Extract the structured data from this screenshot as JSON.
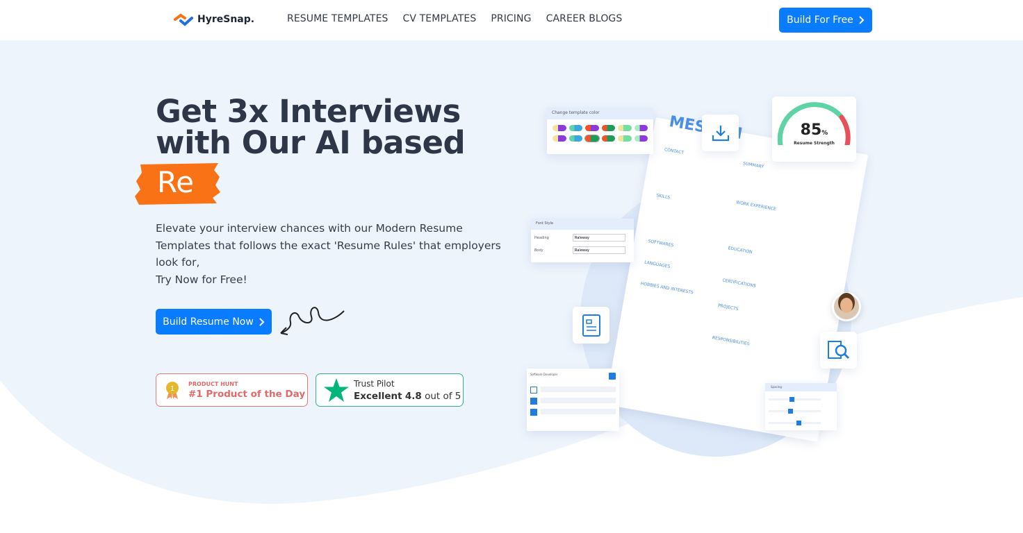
{
  "header": {
    "logo_text": "HyreSnap.",
    "nav": [
      {
        "label": "RESUME TEMPLATES"
      },
      {
        "label": "CV TEMPLATES"
      },
      {
        "label": "PRICING"
      },
      {
        "label": "CAREER BLOGS"
      }
    ],
    "cta_label": "Build For Free"
  },
  "hero": {
    "title_line1": "Get 3x Interviews",
    "title_line2": "with Our AI based",
    "highlight_word": "Re",
    "description_lines": [
      "Elevate your interview chances with our Modern Resume",
      "Templates that follows the exact 'Resume Rules' that employers",
      "look for,",
      "Try Now for Free!"
    ],
    "cta_label": "Build Resume Now",
    "badges": {
      "product_hunt": {
        "label": "PRODUCT HUNT",
        "title": "#1 Product of the Day",
        "medal_number": "1"
      },
      "trust_pilot": {
        "label": "Trust Pilot",
        "rating_prefix": "Excellent",
        "rating": "4.8",
        "rating_suffix": "out of 5"
      }
    }
  },
  "illustration": {
    "color_panel_title": "Change template color",
    "resume_name": "MES SMI",
    "gauge_value": "85",
    "gauge_unit": "%",
    "gauge_label": "Resume Strength",
    "font_panel_title": "Font Style",
    "font_fields": [
      {
        "label": "Heading",
        "value": "Raleway"
      },
      {
        "label": "Body",
        "value": "Raleway"
      }
    ],
    "spacing_panel_title": "Spacing",
    "search_panel_title": "Software Developer",
    "resume_sections": [
      "CONTACT",
      "SUMMARY",
      "SKILLS",
      "WORK EXPERIENCE",
      "EDUCATION",
      "SOFTWARES",
      "LANGUAGES",
      "CERTIFICATIONS",
      "HOBBIES AND INTERESTS",
      "PROJECTS",
      "RESPONSIBILITIES"
    ]
  },
  "colors": {
    "accent": "#0a7cff",
    "heading": "#2d3748",
    "brush": "#f97316",
    "product_hunt": "#e06a6a",
    "trust_pilot": "#00b67a",
    "hero_bg": "#eef4fc"
  }
}
